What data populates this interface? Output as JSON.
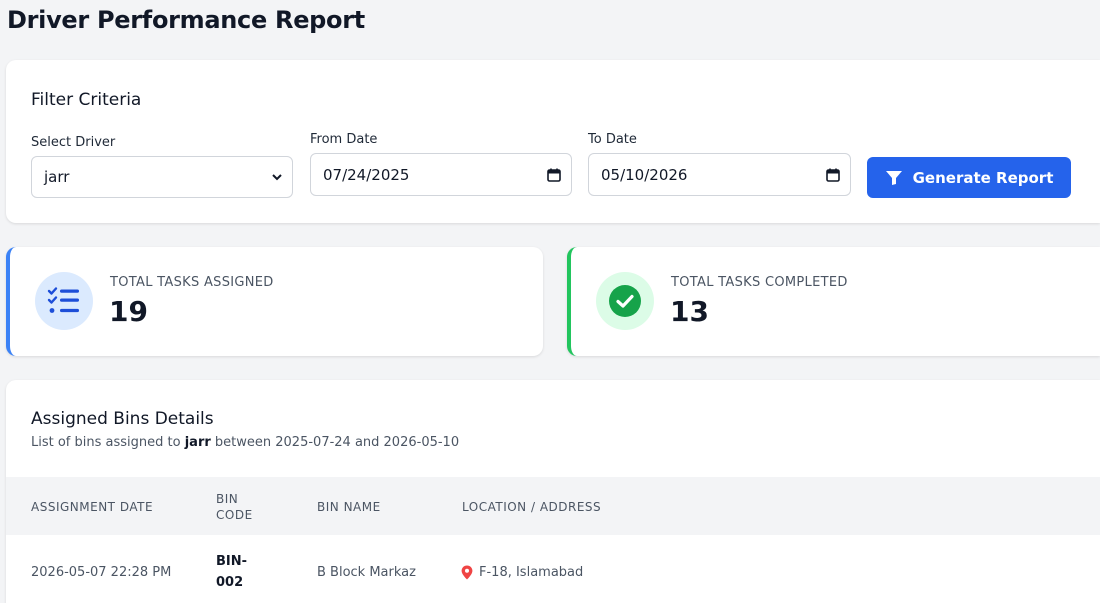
{
  "page": {
    "title": "Driver Performance Report"
  },
  "filter": {
    "title": "Filter Criteria",
    "driver_label": "Select Driver",
    "driver_value": "jarr",
    "from_label": "From Date",
    "from_value": "07/24/2025",
    "to_label": "To Date",
    "to_value": "05/10/2026",
    "generate_label": "Generate Report"
  },
  "stats": {
    "assigned_label": "TOTAL TASKS ASSIGNED",
    "assigned_value": "19",
    "completed_label": "TOTAL TASKS COMPLETED",
    "completed_value": "13"
  },
  "details": {
    "title": "Assigned Bins Details",
    "subtitle_prefix": "List of bins assigned to",
    "subtitle_driver": "jarr",
    "subtitle_between": "between 2025-07-24 and 2026-05-10",
    "columns": [
      "ASSIGNMENT DATE",
      "BIN",
      "CODE",
      "BIN NAME",
      "LOCATION / ADDRESS"
    ],
    "rows": [
      {
        "date": "2026-05-07 22:28 PM",
        "code_line1": "BIN-",
        "code_line2": "002",
        "name": "B Block Markaz",
        "location": "F-18, Islamabad"
      }
    ]
  },
  "colors": {
    "primary": "#2563eb",
    "assigned_accent": "#3b82f6",
    "completed_accent": "#22c55e",
    "pin": "#ef4444"
  },
  "icons": [
    "select-chevron-icon",
    "calendar-icon",
    "filter-icon",
    "task-list-icon",
    "check-circle-icon",
    "map-pin-icon"
  ]
}
